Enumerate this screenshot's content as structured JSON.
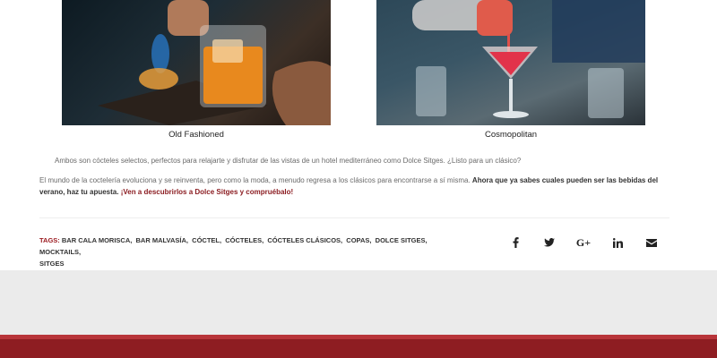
{
  "figures": [
    {
      "caption": "Old Fashioned"
    },
    {
      "caption": "Cosmopolitan"
    }
  ],
  "article": {
    "para1": "Ambos son cócteles selectos, perfectos para relajarte y disfrutar de las vistas de un hotel mediterráneo como Dolce Sitges. ¿Listo para un clásico?",
    "para2_text": "El mundo de la coctelería evoluciona y se reinventa, pero como la moda, a menudo regresa a los clásicos para encontrarse a sí misma. ",
    "para2_bold": "Ahora que ya sabes cuales pueden ser las bebidas del verano, haz tu apuesta.",
    "para2_cta": " ¡Ven a descubrirlos a Dolce Sitges y compruébalo!"
  },
  "tags": {
    "label": "TAGS:",
    "items": [
      "BAR CALA MORISCA,",
      "BAR MALVASÍA,",
      "CÓCTEL,",
      "CÓCTELES,",
      "CÓCTELES CLÁSICOS,",
      "COPAS,",
      "DOLCE SITGES,",
      "MOCKTAILS,",
      "SITGES"
    ]
  },
  "share": {
    "icons": [
      "facebook-icon",
      "twitter-icon",
      "google-plus-icon",
      "linkedin-icon",
      "email-icon"
    ],
    "google_plus_label": "G+"
  },
  "colors": {
    "accent": "#9b1b20",
    "footer_red": "#8e1d22",
    "gray_band": "#ebebeb"
  }
}
